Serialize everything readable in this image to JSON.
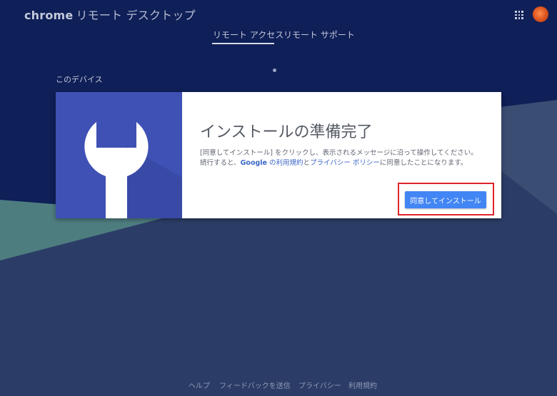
{
  "header": {
    "brand": "chrome",
    "app_name": "リモート デスクトップ",
    "apps_icon": "apps-grid-icon",
    "avatar_icon": "user-avatar"
  },
  "tabs": [
    {
      "label": "リモート アクセス",
      "selected": true
    },
    {
      "label": "リモート サポート",
      "selected": false
    }
  ],
  "section": {
    "label": "このデバイス"
  },
  "card": {
    "icon": "wrench-icon",
    "heading": "インストールの準備完了",
    "desc_line1": "[同意してインストール] をクリックし、表示されるメッセージに沿って操作してください。",
    "desc_line2_prefix": "続行すると、",
    "desc_google": "Google",
    "desc_terms_link": " の利用規約",
    "desc_and": "と",
    "desc_privacy_link": "プライバシー ポリシー",
    "desc_line2_suffix": "に同意したことになります。",
    "install_button": "同意してインストール"
  },
  "footer": {
    "help": "ヘルプ",
    "feedback": "フィードバックを送信",
    "privacy": "プライバシー",
    "terms": "利用規約"
  },
  "colors": {
    "accent": "#4285f4",
    "illustration_bg": "#3f51b5",
    "highlight": "#e0232a",
    "page_top": "#0f1f57",
    "page_bottom": "#2a3c66"
  }
}
